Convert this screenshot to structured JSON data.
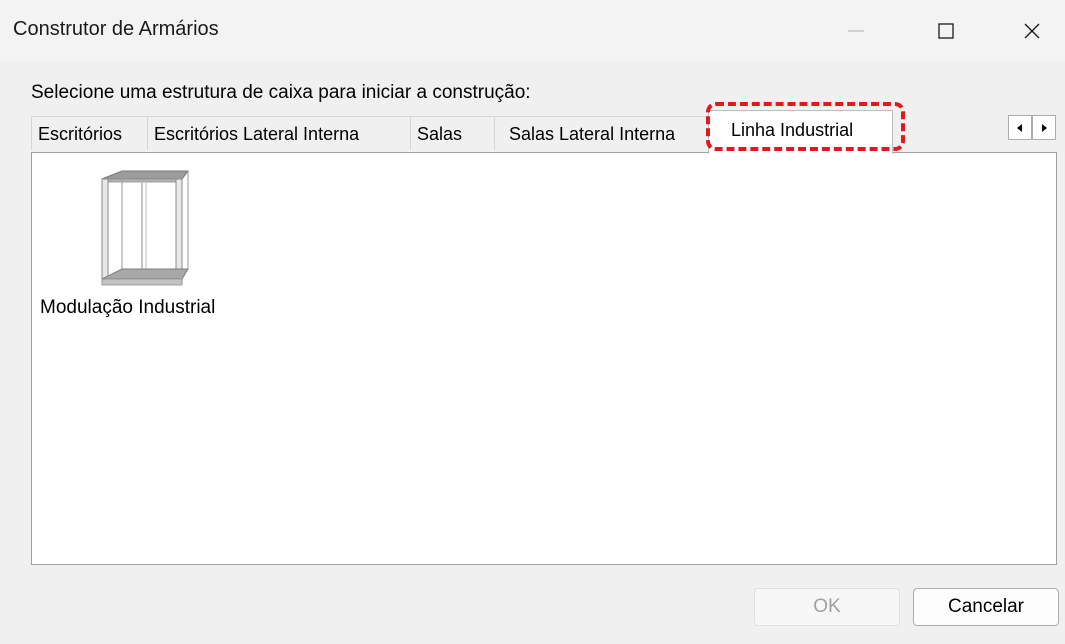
{
  "window": {
    "title": "Construtor de Armários"
  },
  "dialog": {
    "prompt": "Selecione uma estrutura de caixa para iniciar a construção:",
    "tabs": [
      {
        "label": "Escritórios",
        "active": false
      },
      {
        "label": "Escritórios Lateral Interna",
        "active": false
      },
      {
        "label": "Salas",
        "active": false
      },
      {
        "label": "Salas Lateral Interna",
        "active": false
      },
      {
        "label": "Linha Industrial",
        "active": true
      }
    ],
    "items": [
      {
        "label": "Modulação Industrial",
        "icon": "cabinet-icon"
      }
    ],
    "ok_label": "OK",
    "cancel_label": "Cancelar"
  },
  "colors": {
    "highlight": "#e0191f",
    "background": "#f0f0f0",
    "panel": "#ffffff"
  }
}
